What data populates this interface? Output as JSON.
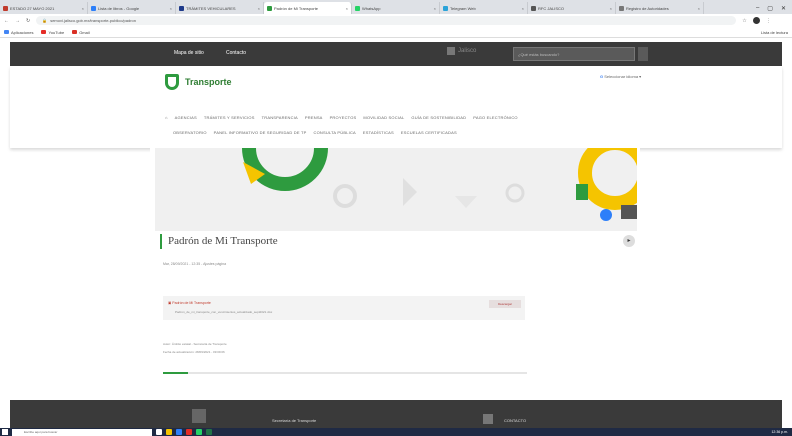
{
  "browser": {
    "tabs": [
      {
        "label": "ESTADO 27 MAYO 2021",
        "color": "#c0392b",
        "active": false
      },
      {
        "label": "Lista de libros - Google",
        "color": "#2d7ff9",
        "active": false
      },
      {
        "label": "TRÁMITES VEHICULARES",
        "color": "#1e3a8a",
        "active": false
      },
      {
        "label": "Padrón de Mi Transporte",
        "color": "#2e9b3f",
        "active": true
      },
      {
        "label": "WhatsApp",
        "color": "#25d366",
        "active": false
      },
      {
        "label": "Telegram Web",
        "color": "#2aa3d9",
        "active": false
      },
      {
        "label": "RFC JALISCO",
        "color": "#555555",
        "active": false
      },
      {
        "label": "Registro de Autoridades",
        "color": "#777777",
        "active": false
      }
    ],
    "url": "semovi.jalisco.gob.mx/transporte-publico/padron",
    "bookmarks": [
      {
        "label": "Aplicaciones",
        "color": "#4285f4"
      },
      {
        "label": "YouTube",
        "color": "#e52d27"
      },
      {
        "label": "Gmail",
        "color": "#d93025"
      }
    ],
    "bookmarks_right": "Lista de lectura"
  },
  "topbar": {
    "site_map": "Mapa de sitio",
    "contact": "Contacto",
    "gob": "Jalisco",
    "search_placeholder": "¿Qué estás buscando?"
  },
  "header": {
    "logo_text": "Transporte",
    "language": "Seleccionar idioma",
    "nav_row1": [
      "AGENCIAS",
      "TRÁMITES Y SERVICIOS",
      "TRANSPARENCIA",
      "PRENSA",
      "PROYECTOS",
      "MOVILIDAD SOCIAL",
      "GUÍA DE SOSTENIBILIDAD",
      "PAGO ELECTRÓNICO"
    ],
    "nav_row2": [
      "OBSERVATORIO",
      "PANEL INFORMATIVO DE SEGURIDAD DE TP",
      "CONSULTA PÚBLICA",
      "ESTADÍSTICAS",
      "ESCUELAS CERTIFICADAS"
    ]
  },
  "page": {
    "title": "Padrón de Mi Transporte",
    "date": "Mar, 28/09/2021 - 12:35 - Ajustes página",
    "attachment": {
      "name": "Padrón de Mi Transporte",
      "file": "Padron_de_mi_transporte_con_vencimientos_actualizado_sept2021.xlsx",
      "button": "Descargar"
    },
    "meta_author": "Autor: Ámbito estatal - Secretaría de Transporte",
    "meta_updated": "Fecha de actualización: 28/09/2021 - 09:09:06",
    "progress": 0.07
  },
  "footer": {
    "org": "Secretaría de Transporte",
    "contact": "CONTACTO"
  },
  "taskbar": {
    "search": "Escribe aquí para buscar",
    "clock": "12:36 p.m."
  }
}
